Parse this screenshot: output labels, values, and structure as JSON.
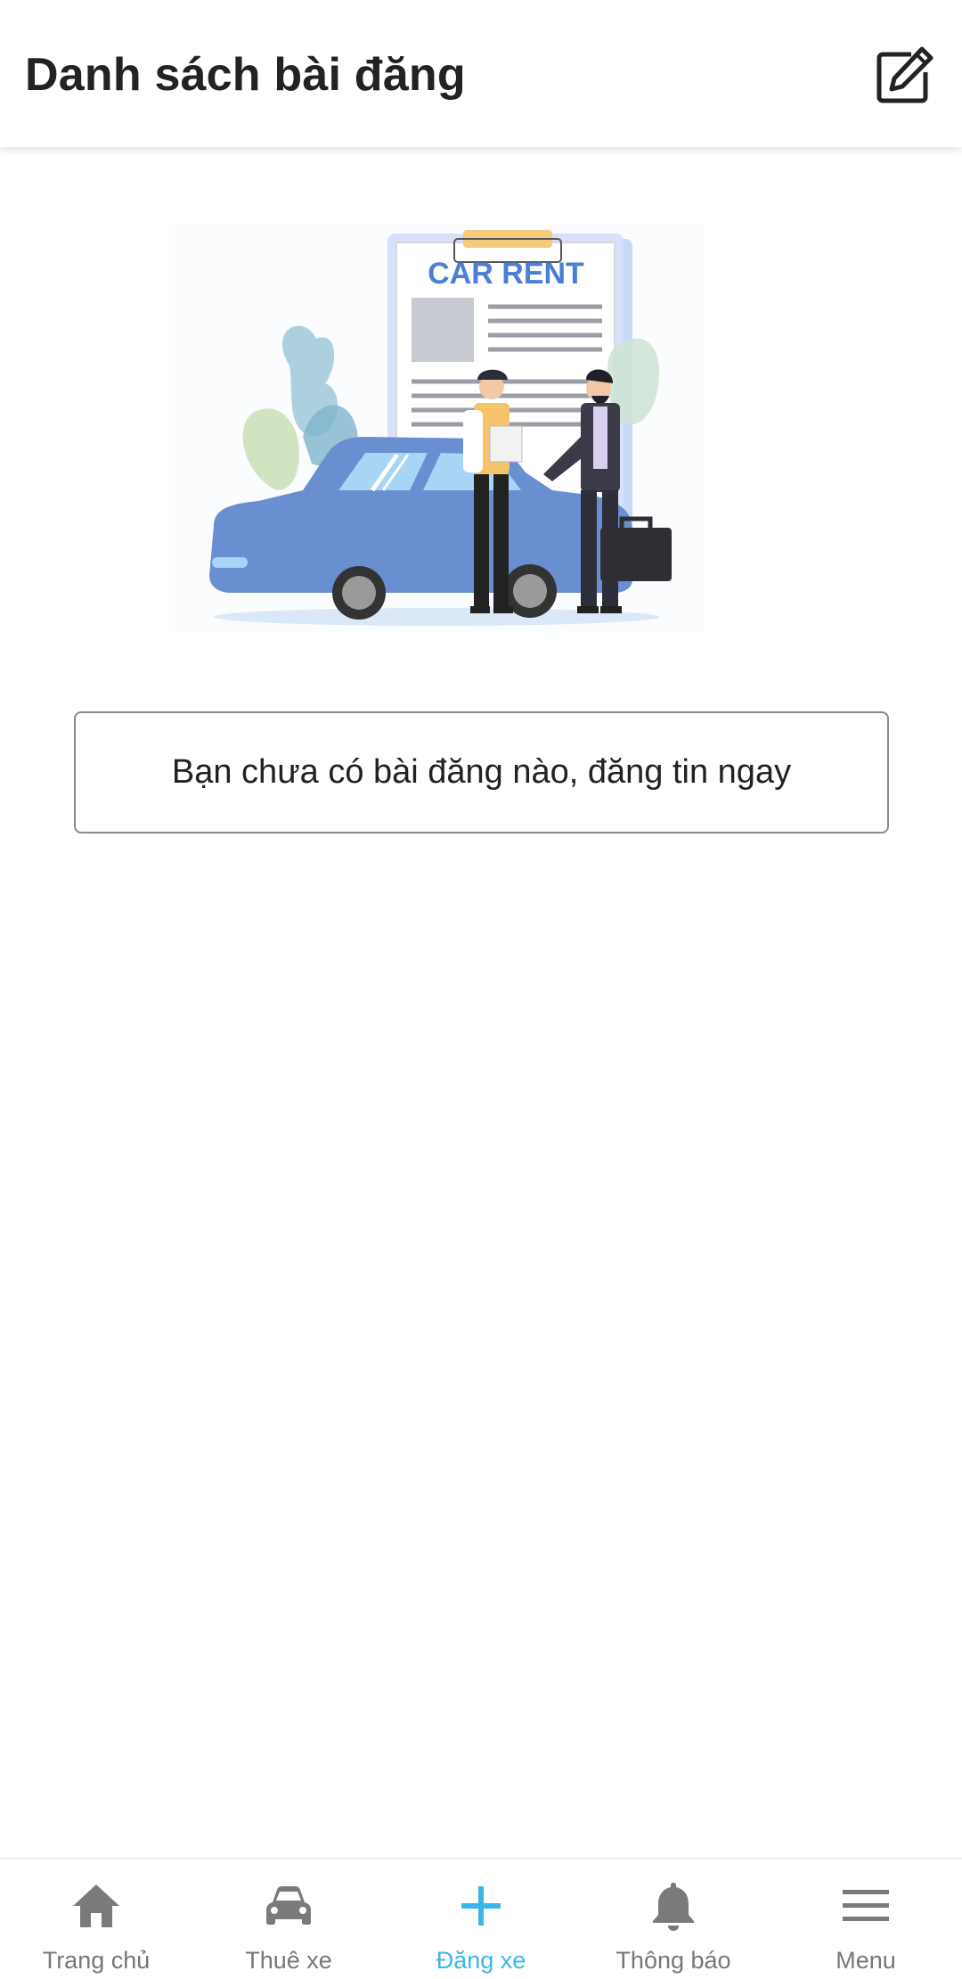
{
  "header": {
    "title": "Danh sách bài đăng",
    "edit_icon": "edit-icon"
  },
  "illustration": {
    "sign_text": "CAR RENT"
  },
  "empty_state": {
    "cta_text": "Bạn chưa có bài đăng nào, đăng tin ngay"
  },
  "bottom_nav": {
    "items": [
      {
        "label": "Trang chủ",
        "icon": "home-icon",
        "active": false
      },
      {
        "label": "Thuê xe",
        "icon": "car-icon",
        "active": false
      },
      {
        "label": "Đăng xe",
        "icon": "plus-icon",
        "active": true
      },
      {
        "label": "Thông báo",
        "icon": "bell-icon",
        "active": false
      },
      {
        "label": "Menu",
        "icon": "menu-icon",
        "active": false
      }
    ]
  },
  "colors": {
    "accent": "#39b6ea",
    "nav_inactive": "#777777",
    "car_body": "#6a8fd0",
    "sign_text": "#4a7fd6"
  }
}
